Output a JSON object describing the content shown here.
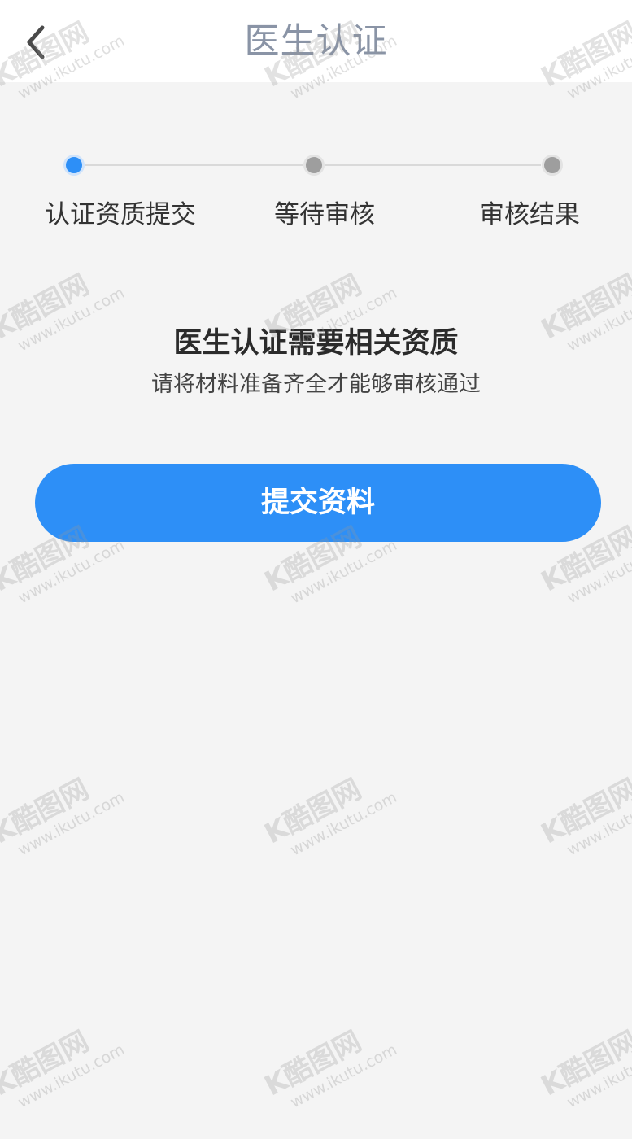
{
  "header": {
    "title": "医生认证",
    "back_icon": "chevron-left-icon"
  },
  "steps": [
    {
      "label": "认证资质提交",
      "state": "active"
    },
    {
      "label": "等待审核",
      "state": "pending"
    },
    {
      "label": "审核结果",
      "state": "pending"
    }
  ],
  "intro": {
    "title": "医生认证需要相关资质",
    "subtitle": "请将材料准备齐全才能够审核通过"
  },
  "actions": {
    "submit_label": "提交资料"
  },
  "colors": {
    "accent": "#2d8ff7",
    "background": "#f4f4f4",
    "inactive_dot": "#9e9e9e",
    "title_gray": "#8a94a6"
  },
  "watermark": {
    "brand": "酷图网",
    "url": "www.ikutu.com"
  }
}
